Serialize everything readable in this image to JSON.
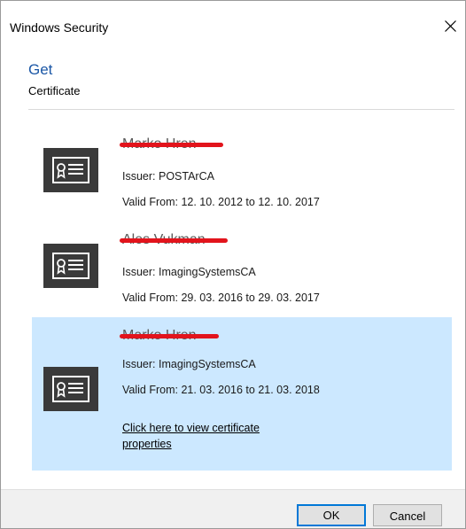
{
  "window": {
    "title": "Windows Security",
    "close_icon": "close-icon"
  },
  "header": {
    "heading": "Get",
    "subheading": "Certificate"
  },
  "certificates": [
    {
      "name": "Marko Hren",
      "issuer": "Issuer: POSTArCA",
      "validity": "Valid From: 12. 10. 2012 to 12. 10. 2017",
      "icon": "certificate-icon",
      "selected": false,
      "name_redacted": true
    },
    {
      "name": "Ales Vukman",
      "issuer": "Issuer: ImagingSystemsCA",
      "validity": "Valid From: 29. 03. 2016 to 29. 03. 2017",
      "icon": "certificate-icon",
      "selected": false,
      "name_redacted": true
    },
    {
      "name": "Marko Hren",
      "issuer": "Issuer: ImagingSystemsCA",
      "validity": "Valid From: 21. 03. 2016 to 21. 03. 2018",
      "icon": "certificate-icon",
      "selected": true,
      "name_redacted": true,
      "link": "Click here to view certificate properties"
    }
  ],
  "buttons": {
    "ok": "OK",
    "cancel": "Cancel"
  },
  "colors": {
    "heading": "#1b57a6",
    "selection": "#cce8ff",
    "redaction": "#e2141c",
    "primary_button_border": "#0078d7",
    "icon_background": "#3a3a3a"
  }
}
